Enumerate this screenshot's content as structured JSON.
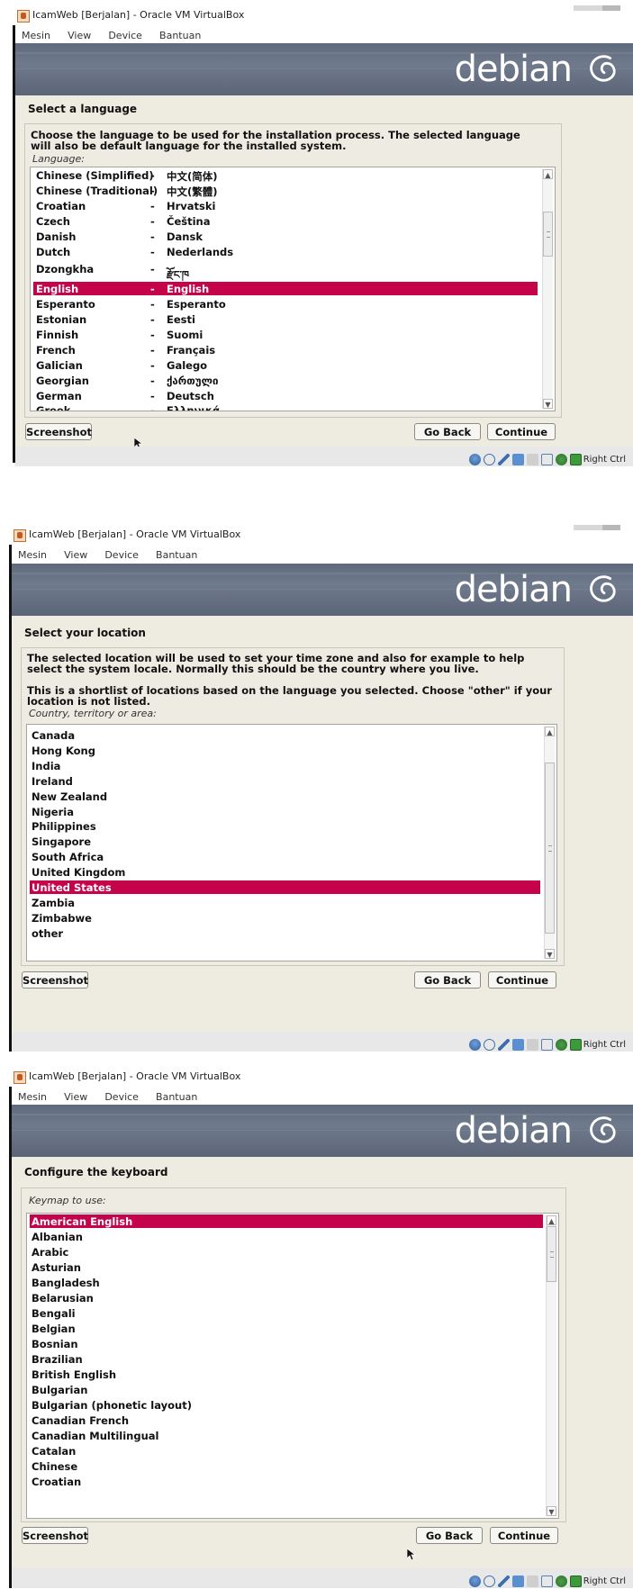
{
  "window_title": "IcamWeb [Berjalan] - Oracle VM VirtualBox",
  "menu": [
    "Mesin",
    "View",
    "Device",
    "Bantuan"
  ],
  "logo": "debian",
  "host_key": "Right Ctrl",
  "buttons": {
    "screenshot": "Screenshot",
    "go_back": "Go Back",
    "continue": "Continue"
  },
  "screen1": {
    "title": "Select a language",
    "description": "Choose the language to be used for the installation process. The selected language will also be default language for the installed system.",
    "field_label": "Language:",
    "languages": [
      {
        "name": "Chinese (Simplified)",
        "sep": "-",
        "native": "中文(简体)"
      },
      {
        "name": "Chinese (Traditional)",
        "sep": "-",
        "native": "中文(繁體)"
      },
      {
        "name": "Croatian",
        "sep": "-",
        "native": "Hrvatski"
      },
      {
        "name": "Czech",
        "sep": "-",
        "native": "Čeština"
      },
      {
        "name": "Danish",
        "sep": "-",
        "native": "Dansk"
      },
      {
        "name": "Dutch",
        "sep": "-",
        "native": "Nederlands"
      },
      {
        "name": "Dzongkha",
        "sep": "-",
        "native": "རྫོང་ཁ"
      },
      {
        "name": "English",
        "sep": "-",
        "native": "English"
      },
      {
        "name": "Esperanto",
        "sep": "-",
        "native": "Esperanto"
      },
      {
        "name": "Estonian",
        "sep": "-",
        "native": "Eesti"
      },
      {
        "name": "Finnish",
        "sep": "-",
        "native": "Suomi"
      },
      {
        "name": "French",
        "sep": "-",
        "native": "Français"
      },
      {
        "name": "Galician",
        "sep": "-",
        "native": "Galego"
      },
      {
        "name": "Georgian",
        "sep": "-",
        "native": "ქართული"
      },
      {
        "name": "German",
        "sep": "-",
        "native": "Deutsch"
      },
      {
        "name": "Greek",
        "sep": "-",
        "native": "Ελληνικά"
      }
    ],
    "selected": "English"
  },
  "screen2": {
    "title": "Select your location",
    "description1": "The selected location will be used to set your time zone and also for example to help select the system locale. Normally this should be the country where you live.",
    "description2": "This is a shortlist of locations based on the language you selected. Choose \"other\" if your location is not listed.",
    "field_label": "Country, territory or area:",
    "locations": [
      "Canada",
      "Hong Kong",
      "India",
      "Ireland",
      "New Zealand",
      "Nigeria",
      "Philippines",
      "Singapore",
      "South Africa",
      "United Kingdom",
      "United States",
      "Zambia",
      "Zimbabwe",
      "other"
    ],
    "selected": "United States"
  },
  "screen3": {
    "title": "Configure the keyboard",
    "field_label": "Keymap to use:",
    "keymaps": [
      "American English",
      "Albanian",
      "Arabic",
      "Asturian",
      "Bangladesh",
      "Belarusian",
      "Bengali",
      "Belgian",
      "Bosnian",
      "Brazilian",
      "British English",
      "Bulgarian",
      "Bulgarian (phonetic layout)",
      "Canadian French",
      "Canadian Multilingual",
      "Catalan",
      "Chinese",
      "Croatian"
    ],
    "selected": "American English"
  },
  "status_icons": [
    "disk-icon",
    "optical-icon",
    "pen-icon",
    "network-icon",
    "shared-folder-icon",
    "display-icon",
    "capture-icon",
    "keyboard-icon"
  ]
}
